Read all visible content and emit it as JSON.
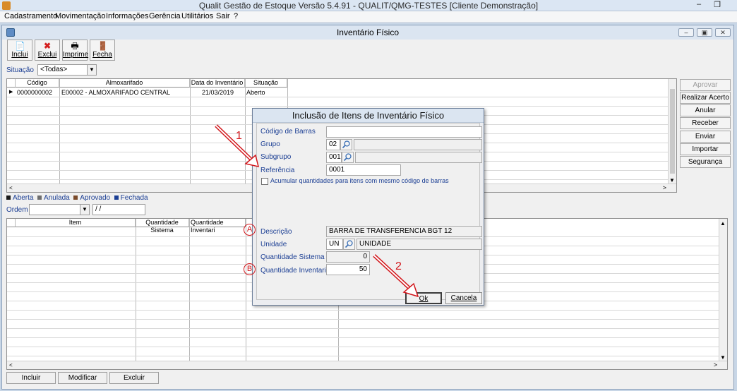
{
  "app": {
    "title": "Qualit Gestão de Estoque Versão 5.4.91 - QUALIT/QMG-TESTES [Cliente Demonstração]",
    "menu": [
      "Cadastramento",
      "Movimentação",
      "Informações",
      "Gerência",
      "Utilitários",
      "Sair",
      "?"
    ]
  },
  "window": {
    "title": "Inventário Físico",
    "toolbar": {
      "incluir": "Inclui",
      "excluir": "Exclui",
      "imprimir": "Imprime",
      "fechar": "Fecha"
    },
    "situacao_label": "Situação",
    "situacao_value": "<Todas>",
    "grid1": {
      "headers": [
        "Código",
        "Almoxarifado",
        "Data do Inventário",
        "Situação"
      ],
      "rows": [
        [
          "0000000002",
          "E00002 - ALMOXARIFADO CENTRAL",
          "21/03/2019",
          "Aberto"
        ]
      ]
    },
    "side_buttons": [
      "Aprovar",
      "Realizar Acerto",
      "Anular",
      "Receber",
      "Enviar",
      "Importar",
      "Segurança"
    ],
    "legend": [
      "Aberta",
      "Anulada",
      "Aprovado",
      "Fechada"
    ],
    "ordem_label": "Ordem",
    "ordem_date": "/ /",
    "grid2": {
      "headers": [
        "Item",
        "Quantidade Sistema",
        "Quantidade Inventari"
      ]
    },
    "bottom_buttons": [
      "Incluir",
      "Modificar",
      "Excluir"
    ]
  },
  "dialog": {
    "title": "Inclusão de Itens de Inventário Físico",
    "fields": {
      "codigo_barras_label": "Código de Barras",
      "codigo_barras_value": "",
      "grupo_label": "Grupo",
      "grupo_value": "02",
      "grupo_desc": "",
      "subgrupo_label": "Subgrupo",
      "subgrupo_value": "001",
      "subgrupo_desc": "",
      "referencia_label": "Referência",
      "referencia_value": "0001",
      "acumular_label": "Acumular quantidades para itens com mesmo código de barras",
      "descricao_label": "Descrição",
      "descricao_value": "BARRA DE TRANSFERENCIA BGT 12",
      "unidade_label": "Unidade",
      "unidade_code": "UN",
      "unidade_desc": "UNIDADE",
      "qtd_sistema_label": "Quantidade Sistema",
      "qtd_sistema_value": "0",
      "qtd_inventariada_label": "Quantidade Inventariada",
      "qtd_inventariada_value": "50"
    },
    "ok": "Ok",
    "cancel": "Cancela"
  },
  "annotations": {
    "arrow1": "1",
    "arrow2": "2",
    "circle_a": "A",
    "circle_b": "B",
    "color": "#d2161b"
  }
}
